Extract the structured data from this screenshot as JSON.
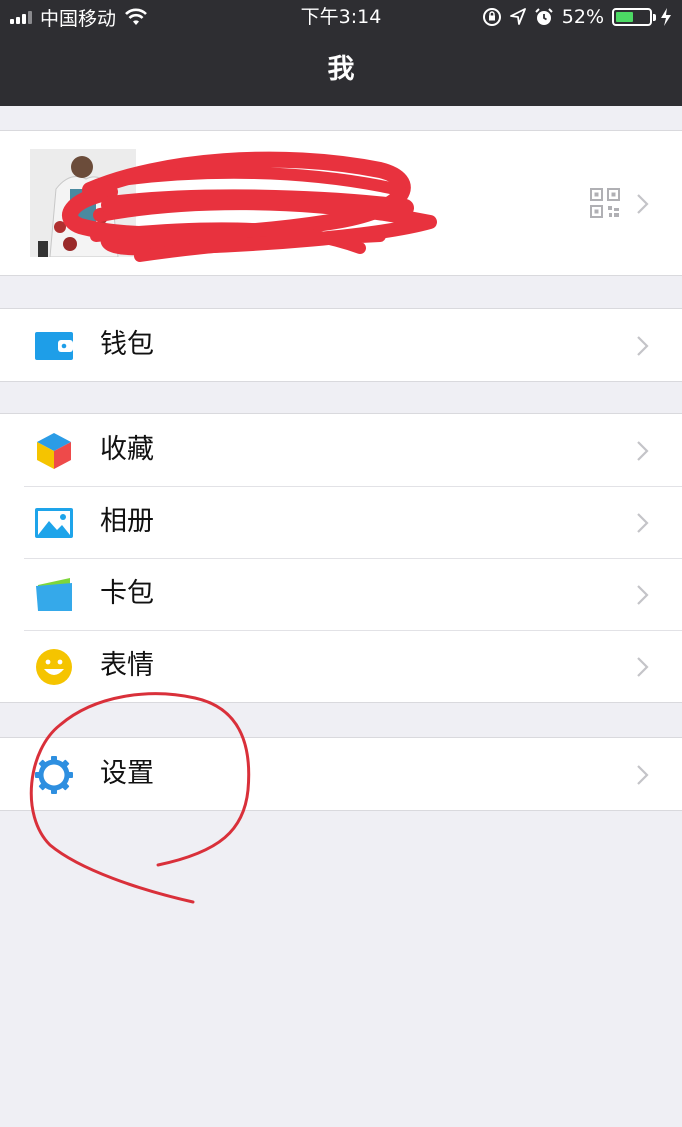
{
  "status_bar": {
    "carrier": "中国移动",
    "time": "下午3:14",
    "battery_percent": "52%",
    "battery_level": 0.52,
    "icons": [
      "signal-icon",
      "wifi-icon",
      "orientation-lock-icon",
      "location-icon",
      "alarm-icon",
      "battery-icon",
      "charging-icon"
    ]
  },
  "nav": {
    "title": "我"
  },
  "profile": {
    "avatar_icon": "avatar",
    "qr_icon": "qr-code-icon",
    "name_redacted": true
  },
  "menu": {
    "wallet": "钱包",
    "favorites": "收藏",
    "album": "相册",
    "cards": "卡包",
    "stickers": "表情",
    "settings": "设置"
  },
  "colors": {
    "nav_bg": "#2e2e32",
    "page_bg": "#efeff4",
    "wallet_blue": "#1e9ee8",
    "settings_blue": "#2e8fe0",
    "sticker_yellow": "#f5c400",
    "annotation_red": "#d9303a"
  }
}
